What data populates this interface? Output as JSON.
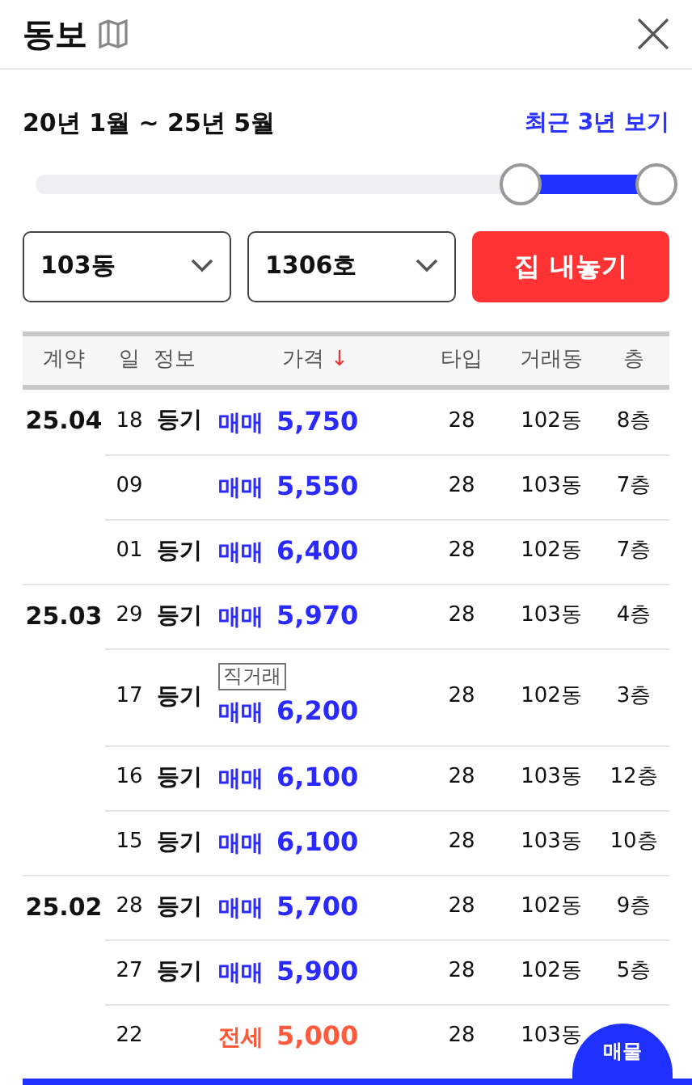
{
  "header": {
    "title": "동보"
  },
  "period": {
    "range": "20년 1월 ~ 25년 5월",
    "recent_link": "최근 3년 보기"
  },
  "slider": {
    "low": {
      "level": 0.78
    },
    "high": {
      "level": 1
    }
  },
  "selects": [
    {
      "value": "103동"
    },
    {
      "value": "1306호"
    }
  ],
  "list_button": "집 내놓기",
  "columns": [
    {
      "label": "계약"
    },
    {
      "label": "일"
    },
    {
      "label": "정보"
    },
    {
      "label": "가격",
      "sort_arrow": "↓"
    },
    {
      "label": "타입"
    },
    {
      "label": "거래동"
    },
    {
      "label": "층"
    }
  ],
  "groups": [
    {
      "month": "25.04",
      "rows": [
        {
          "day": "18",
          "info": "등기",
          "deal": "매매",
          "kind": "sale",
          "price": "5,750",
          "type": "28",
          "dong": "102동",
          "floor": "8층"
        },
        {
          "day": "09",
          "deal": "매매",
          "kind": "sale",
          "price": "5,550",
          "type": "28",
          "dong": "103동",
          "floor": "7층"
        },
        {
          "day": "01",
          "info": "등기",
          "deal": "매매",
          "kind": "sale",
          "price": "6,400",
          "type": "28",
          "dong": "102동",
          "floor": "7층"
        }
      ]
    },
    {
      "month": "25.03",
      "rows": [
        {
          "day": "29",
          "info": "등기",
          "deal": "매매",
          "kind": "sale",
          "price": "5,970",
          "type": "28",
          "dong": "103동",
          "floor": "4층"
        },
        {
          "day": "17",
          "info": "등기",
          "badge": "직거래",
          "deal": "매매",
          "kind": "sale",
          "price": "6,200",
          "type": "28",
          "dong": "102동",
          "floor": "3층"
        },
        {
          "day": "16",
          "info": "등기",
          "deal": "매매",
          "kind": "sale",
          "price": "6,100",
          "type": "28",
          "dong": "103동",
          "floor": "12층"
        },
        {
          "day": "15",
          "info": "등기",
          "deal": "매매",
          "kind": "sale",
          "price": "6,100",
          "type": "28",
          "dong": "103동",
          "floor": "10층"
        }
      ]
    },
    {
      "month": "25.02",
      "rows": [
        {
          "day": "28",
          "info": "등기",
          "deal": "매매",
          "kind": "sale",
          "price": "5,700",
          "type": "28",
          "dong": "102동",
          "floor": "9층"
        },
        {
          "day": "27",
          "info": "등기",
          "deal": "매매",
          "kind": "sale",
          "price": "5,900",
          "type": "28",
          "dong": "102동",
          "floor": "5층"
        },
        {
          "day": "22",
          "deal": "전세",
          "kind": "jeonse",
          "price": "5,000",
          "type": "28",
          "dong": "103동"
        }
      ]
    }
  ],
  "fab": {
    "label": "매물"
  }
}
